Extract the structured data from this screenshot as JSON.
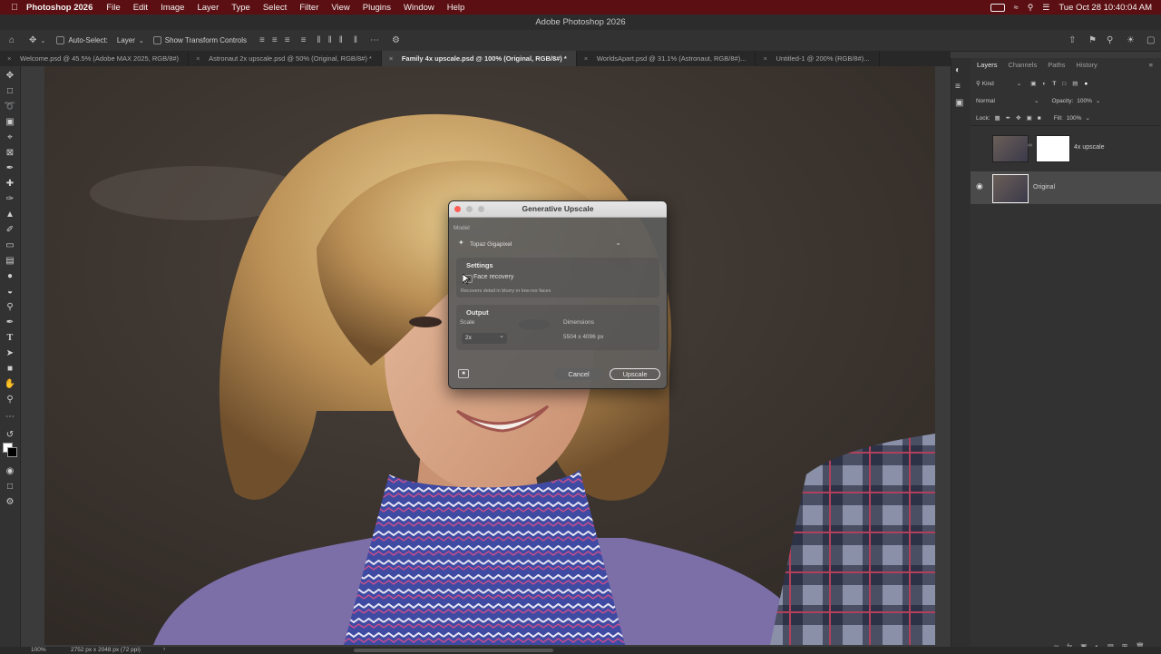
{
  "menubar": {
    "app_name": "Photoshop 2026",
    "items": [
      "File",
      "Edit",
      "Image",
      "Layer",
      "Type",
      "Select",
      "Filter",
      "View",
      "Plugins",
      "Window",
      "Help"
    ],
    "clock": "Tue Oct 28  10:40:04 AM"
  },
  "window_title": "Adobe Photoshop 2026",
  "options_bar": {
    "auto_select_label": "Auto-Select:",
    "auto_select_value": "Layer",
    "show_transform_label": "Show Transform Controls"
  },
  "doc_tabs": [
    {
      "label": "Welcome.psd @ 45.5% (Adobe MAX 2025, RGB/8#)"
    },
    {
      "label": "Astronaut 2x upscale.psd @ 50% (Original, RGB/8#) *"
    },
    {
      "label": "Family 4x upscale.psd @ 100% (Original, RGB/8#) *",
      "active": true
    },
    {
      "label": "WorldsApart.psd @ 31.1% (Astronaut, RGB/8#)..."
    },
    {
      "label": "Untitled-1 @ 200% (RGB/8#)..."
    }
  ],
  "layers_panel": {
    "tabs": [
      "Layers",
      "Channels",
      "Paths",
      "History"
    ],
    "filter_kind": "Kind",
    "blend_mode": "Normal",
    "opacity_label": "Opacity:",
    "opacity_value": "100%",
    "lock_label": "Lock:",
    "fill_label": "Fill:",
    "fill_value": "100%",
    "layers": [
      {
        "name": "4x upscale",
        "visible": false,
        "selected": false
      },
      {
        "name": "Original",
        "visible": true,
        "selected": true
      }
    ]
  },
  "status": {
    "zoom": "100%",
    "doc_info": "2752 px x 2048 px (72 ppi)"
  },
  "dialog": {
    "title": "Generative Upscale",
    "model_label": "Model",
    "model_value": "Topaz Gigapixel",
    "settings_heading": "Settings",
    "face_recovery_label": "Face recovery",
    "face_recovery_checked": false,
    "face_recovery_desc": "Recovers detail in blurry or low-res faces",
    "output_heading": "Output",
    "scale_label": "Scale",
    "scale_value": "2x",
    "dimensions_label": "Dimensions",
    "dimensions_value": "5504 x 4096 px",
    "cancel_label": "Cancel",
    "upscale_label": "Upscale"
  },
  "colors": {
    "menubar_bg": "#5c0f12",
    "ui_dark": "#323232",
    "accent": "#1473e6"
  }
}
